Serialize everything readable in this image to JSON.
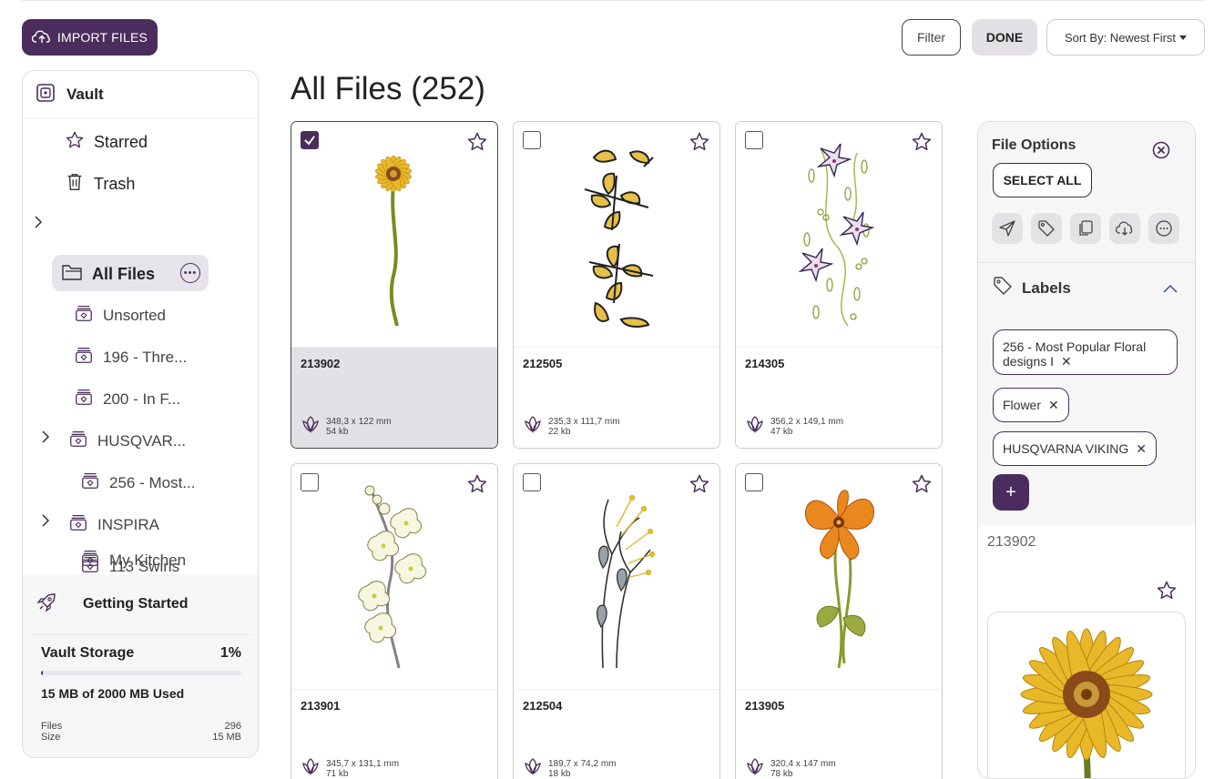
{
  "toolbar": {
    "import_label": "IMPORT FILES",
    "filter_label": "Filter",
    "done_label": "DONE",
    "sort_label": "Sort By: Newest First"
  },
  "sidebar": {
    "vault_label": "Vault",
    "items": [
      {
        "label": "Starred",
        "icon": "star-icon"
      },
      {
        "label": "Trash",
        "icon": "trash-icon"
      },
      {
        "label": "All Files",
        "icon": "folder-icon",
        "active": true
      },
      {
        "label": "Unsorted",
        "icon": "label-stack-icon"
      },
      {
        "label": "196 - Thre...",
        "icon": "label-stack-icon"
      },
      {
        "label": "200 - In F...",
        "icon": "label-stack-icon"
      },
      {
        "label": "HUSQVAR...",
        "icon": "label-stack-icon"
      },
      {
        "label": "256 - Most...",
        "icon": "label-stack-icon"
      },
      {
        "label": "INSPIRA",
        "icon": "label-stack-icon"
      },
      {
        "label": "113 Swirls",
        "icon": "label-stack-icon"
      },
      {
        "label": "My Kitchen",
        "icon": "label-stack-icon"
      }
    ],
    "getting_started": "Getting Started",
    "storage": {
      "title": "Vault Storage",
      "percent_label": "1%",
      "percent": 1,
      "used_label": "15 MB of 2000 MB Used",
      "files_label": "Files",
      "files_value": "296",
      "size_label": "Size",
      "size_value": "15 MB"
    }
  },
  "main": {
    "title": "All Files (252)",
    "cards": [
      {
        "name": "213902",
        "dims": "348,3 x 122 mm",
        "size": "54 kb",
        "checked": true
      },
      {
        "name": "212505",
        "dims": "235,3 x 111,7 mm",
        "size": "22 kb",
        "checked": false
      },
      {
        "name": "214305",
        "dims": "356,2 x 149,1 mm",
        "size": "47 kb",
        "checked": false
      },
      {
        "name": "213901",
        "dims": "345,7 x 131,1 mm",
        "size": "71 kb",
        "checked": false
      },
      {
        "name": "212504",
        "dims": "189,7 x 74,2 mm",
        "size": "18 kb",
        "checked": false
      },
      {
        "name": "213905",
        "dims": "320,4 x 147 mm",
        "size": "78 kb",
        "checked": false
      }
    ]
  },
  "file_options": {
    "title": "File Options",
    "select_all": "SELECT ALL",
    "labels_title": "Labels",
    "labels": [
      {
        "line1": "256 - Most Popular Floral",
        "line2": "designs I"
      },
      {
        "line1": "Flower"
      },
      {
        "line1": "HUSQVARNA VIKING"
      }
    ],
    "selected_name": "213902"
  },
  "colors": {
    "brand": "#4a2d5c",
    "selected_bg": "#e3e0e6",
    "panel_bg": "#f6f6f7"
  }
}
